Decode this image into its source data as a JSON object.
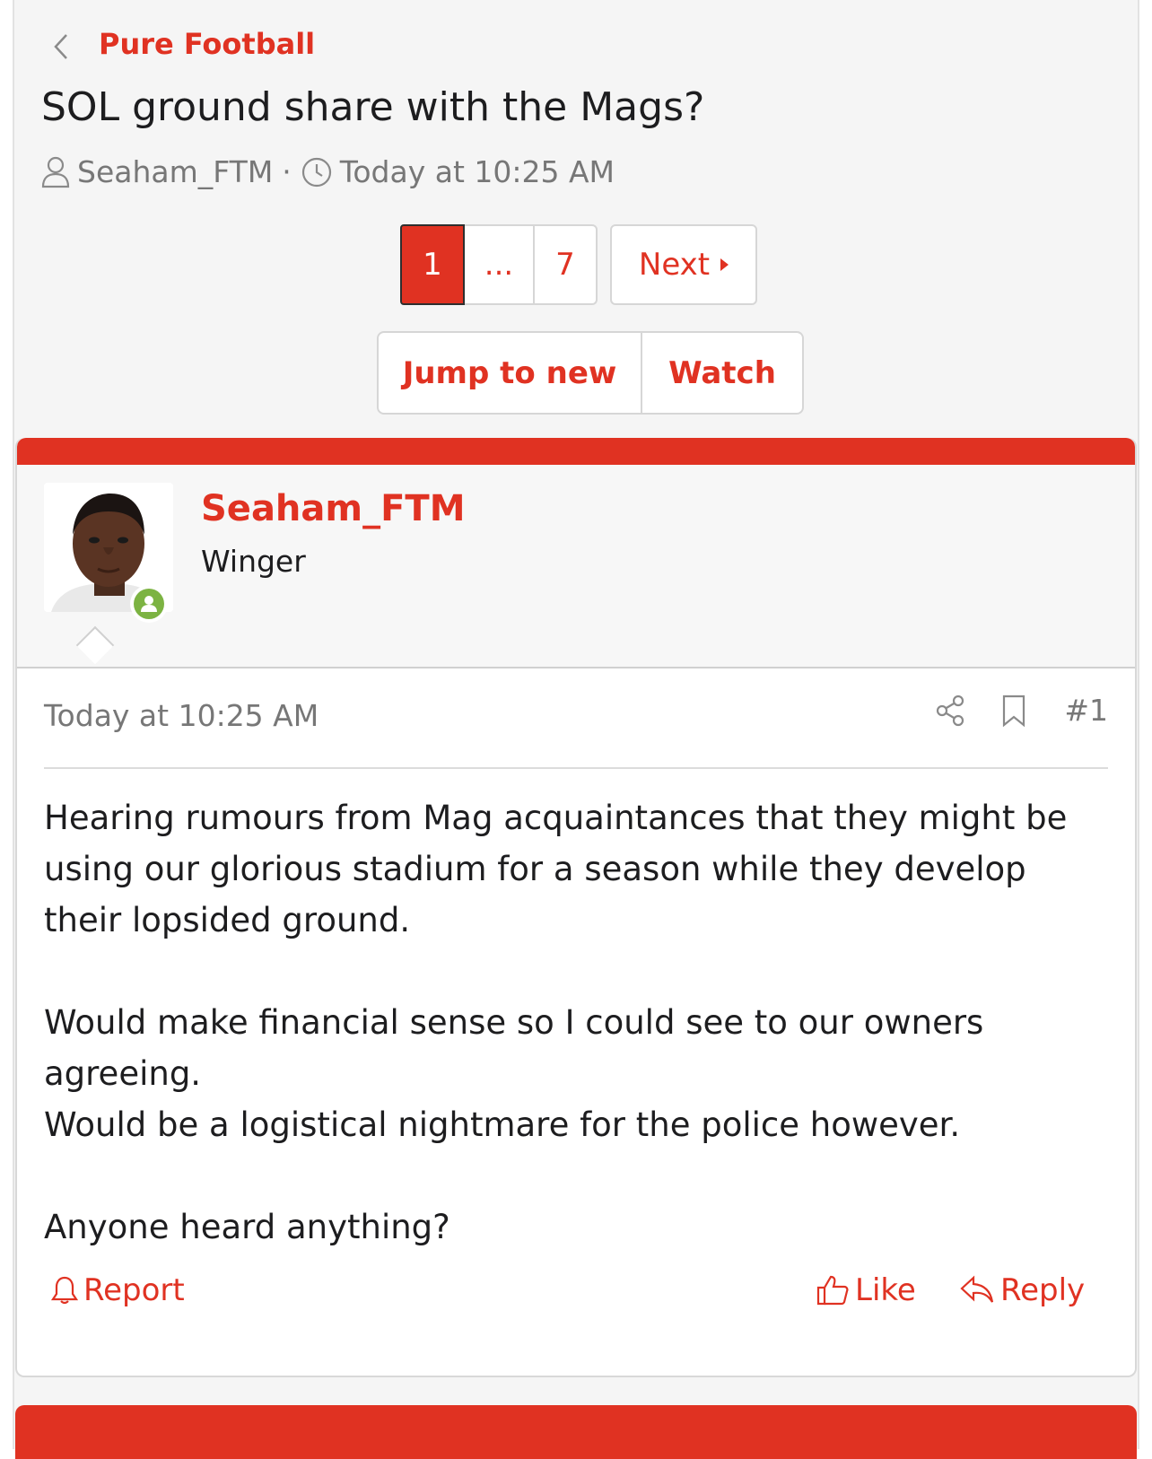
{
  "breadcrumb": {
    "back_icon": "chevron-left-icon",
    "forum": "Pure Football"
  },
  "thread": {
    "title": "SOL ground share with the Mags?",
    "author": "Seaham_FTM",
    "separator": "·",
    "time": "Today at 10:25 AM"
  },
  "pagination": {
    "current": "1",
    "ellipsis": "...",
    "last": "7",
    "next": "Next"
  },
  "actions": {
    "jump": "Jump to new",
    "watch": "Watch"
  },
  "post": {
    "username": "Seaham_FTM",
    "user_title": "Winger",
    "date": "Today at 10:25 AM",
    "number": "#1",
    "body": [
      "Hearing rumours from Mag acquaintances that they might be using our glorious stadium for a season while they develop their lopsided ground.",
      "Would make financial sense so I could see to our owners agreeing.",
      "Would be a logistical nightmare for the police however.",
      "Anyone heard anything?"
    ],
    "report": "Report",
    "like": "Like",
    "reply": "Reply"
  },
  "colors": {
    "accent": "#e03222",
    "online": "#7cb342",
    "muted": "#777777"
  }
}
